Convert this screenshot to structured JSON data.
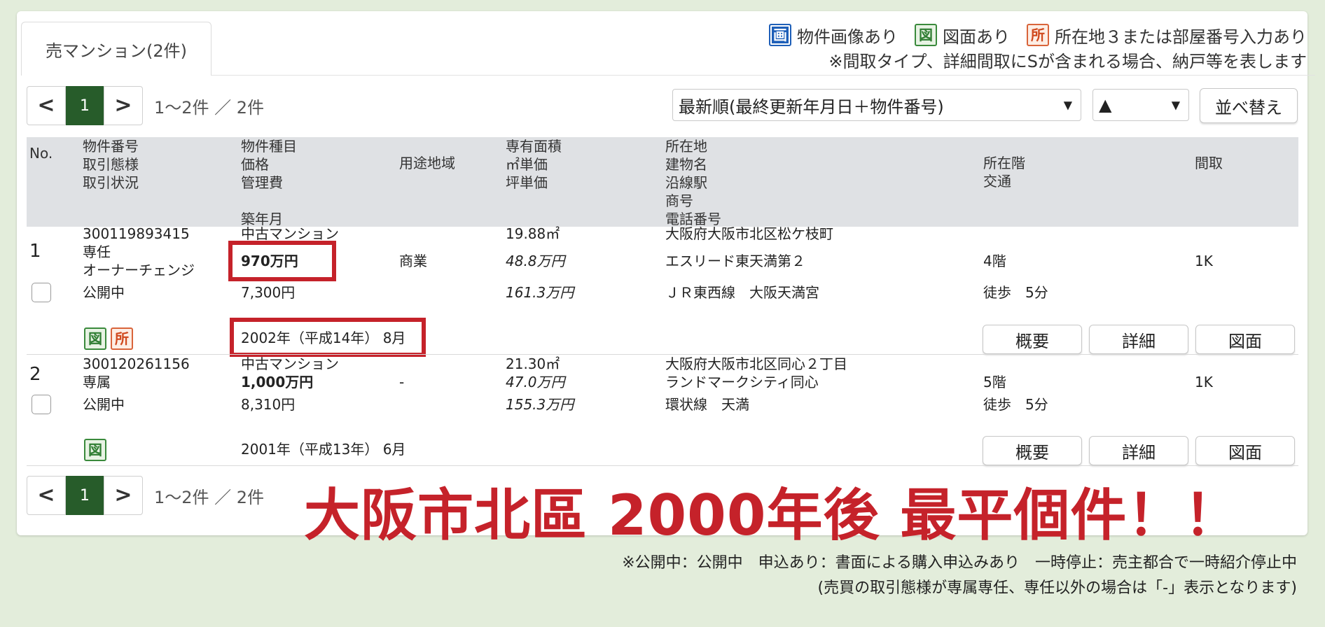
{
  "tab": {
    "label": "売マンション(2件)"
  },
  "legend": {
    "image_badge": "画",
    "image_label": "物件画像あり",
    "plan_badge": "図",
    "plan_label": "図面あり",
    "loc_badge": "所",
    "loc_label": "所在地３または部屋番号入力あり",
    "note": "※間取タイプ、詳細間取にSが含まれる場合、納戸等を表します"
  },
  "pager": {
    "prev_icon": "chevron-left-icon",
    "next_icon": "chevron-right-icon",
    "prev": "<",
    "next": ">",
    "current_page": "1",
    "count_text": "1〜2件 ／ 2件"
  },
  "sort": {
    "order_value": "最新順(最終更新年月日＋物件番号)",
    "direction_value": "▲",
    "button_label": "並べ替え"
  },
  "columns": {
    "no": "No.",
    "id": "物件番号\n取引態様\n取引状況",
    "type": "物件種目\n価格\n管理費\n\n築年月",
    "zoning": "用途地域",
    "area": "専有面積\n㎡単価\n坪単価",
    "address": "所在地\n建物名\n沿線駅\n商号\n電話番号",
    "floor": "所在階\n交通",
    "layout": "間取"
  },
  "rows": [
    {
      "no": "1",
      "id": "300119893415",
      "deal": "専任",
      "status_type": "オーナーチェンジ",
      "status": "公開中",
      "kind": "中古マンション",
      "price": "970万円",
      "mgmt_fee": "7,300円",
      "built": "2002年（平成14年） 8月",
      "zoning": "商業",
      "area": "19.88㎡",
      "sqm_price": "48.8万円",
      "tsubo_price": "161.3万円",
      "address": "大阪府大阪市北区松ケ枝町",
      "building": "エスリード東天満第２",
      "station": "ＪＲ東西線　大阪天満宮",
      "floor": "4階",
      "access": "徒歩　5分",
      "layout": "1K",
      "badges": [
        "図",
        "所"
      ],
      "btn_summary": "概要",
      "btn_detail": "詳細",
      "btn_plan": "図面"
    },
    {
      "no": "2",
      "id": "300120261156",
      "deal": "専属",
      "status": "公開中",
      "kind": "中古マンション",
      "price": "1,000万円",
      "mgmt_fee": "8,310円",
      "built": "2001年（平成13年） 6月",
      "zoning": "-",
      "area": "21.30㎡",
      "sqm_price": "47.0万円",
      "tsubo_price": "155.3万円",
      "address": "大阪府大阪市北区同心２丁目",
      "building": "ランドマークシティ同心",
      "station": "環状線　天満",
      "floor": "5階",
      "access": "徒歩　5分",
      "layout": "1K",
      "badges": [
        "図"
      ],
      "btn_summary": "概要",
      "btn_detail": "詳細",
      "btn_plan": "図面"
    }
  ],
  "overlay_headline": "大阪市北區 2000年後 最平個件！！",
  "footnotes": {
    "line1": "※公開中：公開中　申込あり：書面による購入申込みあり　一時停止：売主都合で一時紹介停止中",
    "line2": "(売買の取引態様が専属専任、専任以外の場合は「-」表示となります)"
  },
  "colors": {
    "accent_green": "#275c2a",
    "highlight_red": "#c5222a",
    "header_gray": "#dfe1e4"
  }
}
